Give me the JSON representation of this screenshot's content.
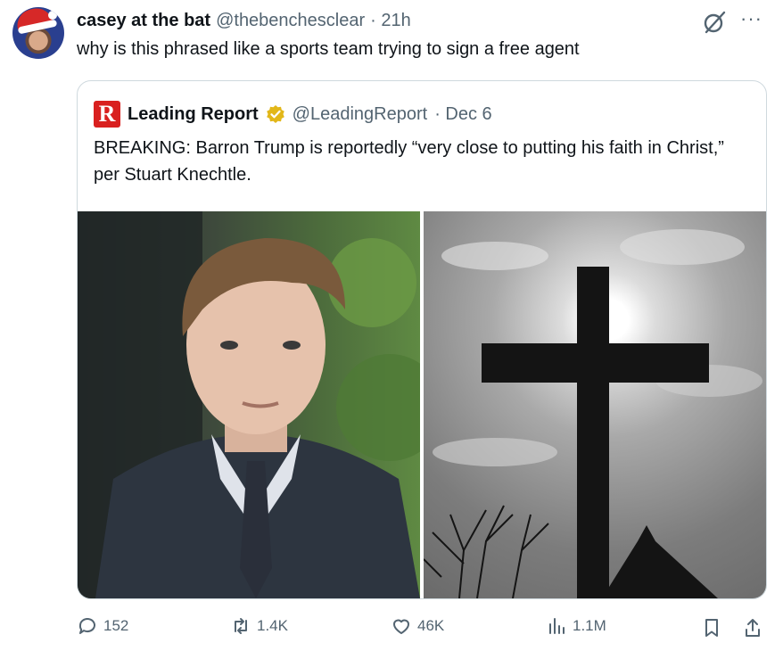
{
  "tweet": {
    "display_name": "casey at the bat",
    "handle": "@thebenchesclear",
    "time": "· 21h",
    "text": "why is this phrased like a sports team trying to sign a free agent",
    "more_label": "···"
  },
  "quoted": {
    "logo_letter": "R",
    "display_name": "Leading Report",
    "handle": "@LeadingReport",
    "date": "· Dec 6",
    "text": "BREAKING: Barron Trump is reportedly  “very close to putting his faith in Christ,” per Stuart Knechtle.",
    "verified_color": "#e2b719",
    "brand_color": "#d9201f"
  },
  "stats": {
    "replies": "152",
    "reposts": "1.4K",
    "likes": "46K",
    "views": "1.1M"
  },
  "icons": [
    "grok-icon",
    "more-icon",
    "verified-badge-icon",
    "reply-icon",
    "repost-icon",
    "like-icon",
    "views-icon",
    "bookmark-icon",
    "share-icon"
  ]
}
